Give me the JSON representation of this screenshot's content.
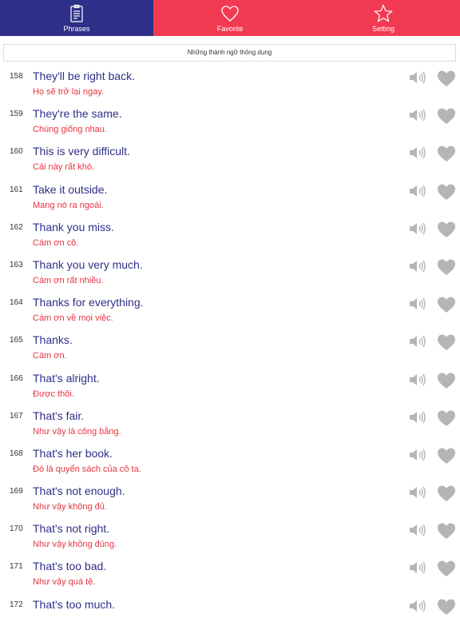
{
  "tabs": {
    "phrases": {
      "label": "Phrases",
      "icon": "clipboard-icon",
      "bg": "#2e2f88"
    },
    "favorite": {
      "label": "Favorite",
      "icon": "heart-outline-icon",
      "bg": "#f23a52"
    },
    "setting": {
      "label": "Setting",
      "icon": "star-outline-icon",
      "bg": "#f23a52"
    }
  },
  "list_header": "Những thành ngữ thông dụng",
  "icons": {
    "speaker": "speaker-icon",
    "favorite": "heart-icon"
  },
  "colors": {
    "english": "#2e2f88",
    "vietnamese": "#e8343f",
    "icon_gray": "#b5b5b5"
  },
  "phrases": [
    {
      "num": "158",
      "en": "They'll be right back.",
      "vi": "Họ sẽ trở lại ngay."
    },
    {
      "num": "159",
      "en": "They're the same.",
      "vi": "Chúng giống nhau."
    },
    {
      "num": "160",
      "en": "This is very difficult.",
      "vi": "Cái này rất khó."
    },
    {
      "num": "161",
      "en": "Take it outside.",
      "vi": "Mang nó ra ngoài."
    },
    {
      "num": "162",
      "en": "Thank you miss.",
      "vi": "Cám ơn cô."
    },
    {
      "num": "163",
      "en": "Thank you very much.",
      "vi": "Cám ơn rất nhiều."
    },
    {
      "num": "164",
      "en": "Thanks for everything.",
      "vi": "Cám ơn về mọi việc."
    },
    {
      "num": "165",
      "en": "Thanks.",
      "vi": "Cám ơn."
    },
    {
      "num": "166",
      "en": "That's alright.",
      "vi": "Được thôi."
    },
    {
      "num": "167",
      "en": "That's fair.",
      "vi": "Như vậy là công bằng."
    },
    {
      "num": "168",
      "en": "That's her book.",
      "vi": "Đó là quyển sách của cô ta."
    },
    {
      "num": "169",
      "en": "That's not enough.",
      "vi": "Như vậy không đủ."
    },
    {
      "num": "170",
      "en": "That's not right.",
      "vi": "Như vậy không đúng."
    },
    {
      "num": "171",
      "en": "That's too bad.",
      "vi": "Như vậy quá tệ."
    },
    {
      "num": "172",
      "en": "That's too much.",
      "vi": ""
    }
  ]
}
